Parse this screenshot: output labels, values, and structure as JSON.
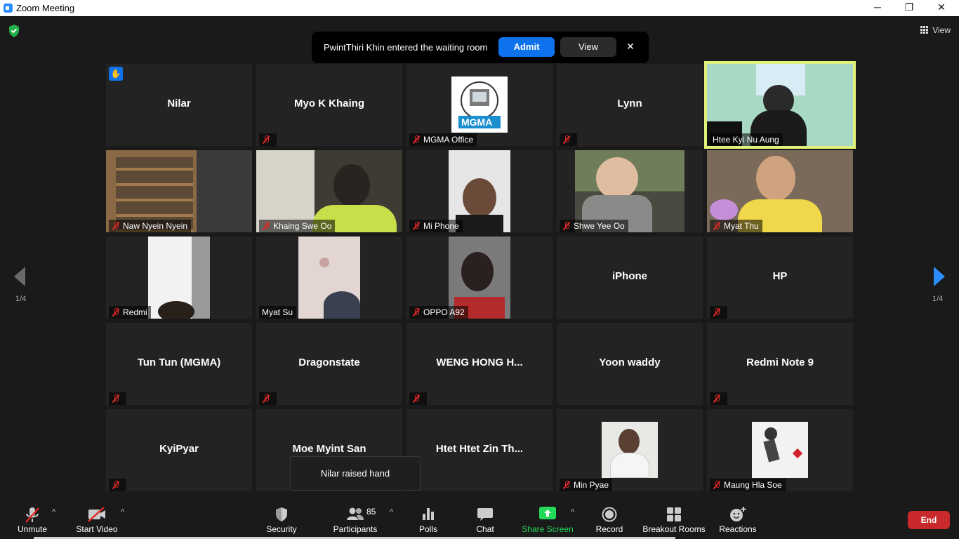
{
  "window": {
    "title": "Zoom Meeting",
    "minimize": "─",
    "restore": "❐",
    "close": "✕"
  },
  "top": {
    "view_label": "View"
  },
  "waiting_room": {
    "message": "PwintThiri Khin entered the waiting room",
    "admit_label": "Admit",
    "view_label": "View",
    "close": "✕"
  },
  "nav": {
    "left_page": "1/4",
    "right_page": "1/4"
  },
  "participants": [
    {
      "name": "Nilar"
    },
    {
      "name": "Myo K Khaing"
    },
    {
      "name": "MGMA Office"
    },
    {
      "name": "Lynn"
    },
    {
      "name": "Htee Kyi Nu Aung"
    },
    {
      "name": "Naw Nyein Nyein"
    },
    {
      "name": "Khaing Swe Oo"
    },
    {
      "name": "Mi Phone"
    },
    {
      "name": "Shwe Yee Oo"
    },
    {
      "name": "Myat Thu"
    },
    {
      "name": "Redmi"
    },
    {
      "name": "Myat Su"
    },
    {
      "name": "OPPO A92"
    },
    {
      "name": "iPhone"
    },
    {
      "name": "HP"
    },
    {
      "name": "Tun Tun (MGMA)"
    },
    {
      "name": "Dragonstate"
    },
    {
      "name": "WENG  HONG  H..."
    },
    {
      "name": "Yoon waddy"
    },
    {
      "name": "Redmi Note 9"
    },
    {
      "name": "KyiPyar"
    },
    {
      "name": "Moe Myint San"
    },
    {
      "name": "Htet  Htet Zin Th..."
    },
    {
      "name": "Min Pyae"
    },
    {
      "name": "Maung Hla Soe"
    }
  ],
  "logo_text": "MGMA",
  "tooltip": "Nilar raised hand",
  "toolbar": {
    "unmute": "Unmute",
    "start_video": "Start Video",
    "security": "Security",
    "participants": "Participants",
    "participants_count": "85",
    "polls": "Polls",
    "chat": "Chat",
    "share_screen": "Share Screen",
    "record": "Record",
    "breakout": "Breakout Rooms",
    "reactions": "Reactions",
    "end": "End",
    "caret": "^"
  },
  "colors": {
    "accent": "#0e72ed",
    "share": "#23d959",
    "end": "#c9292a",
    "muted": "#e02828",
    "active_speaker": "#e1f07a"
  }
}
